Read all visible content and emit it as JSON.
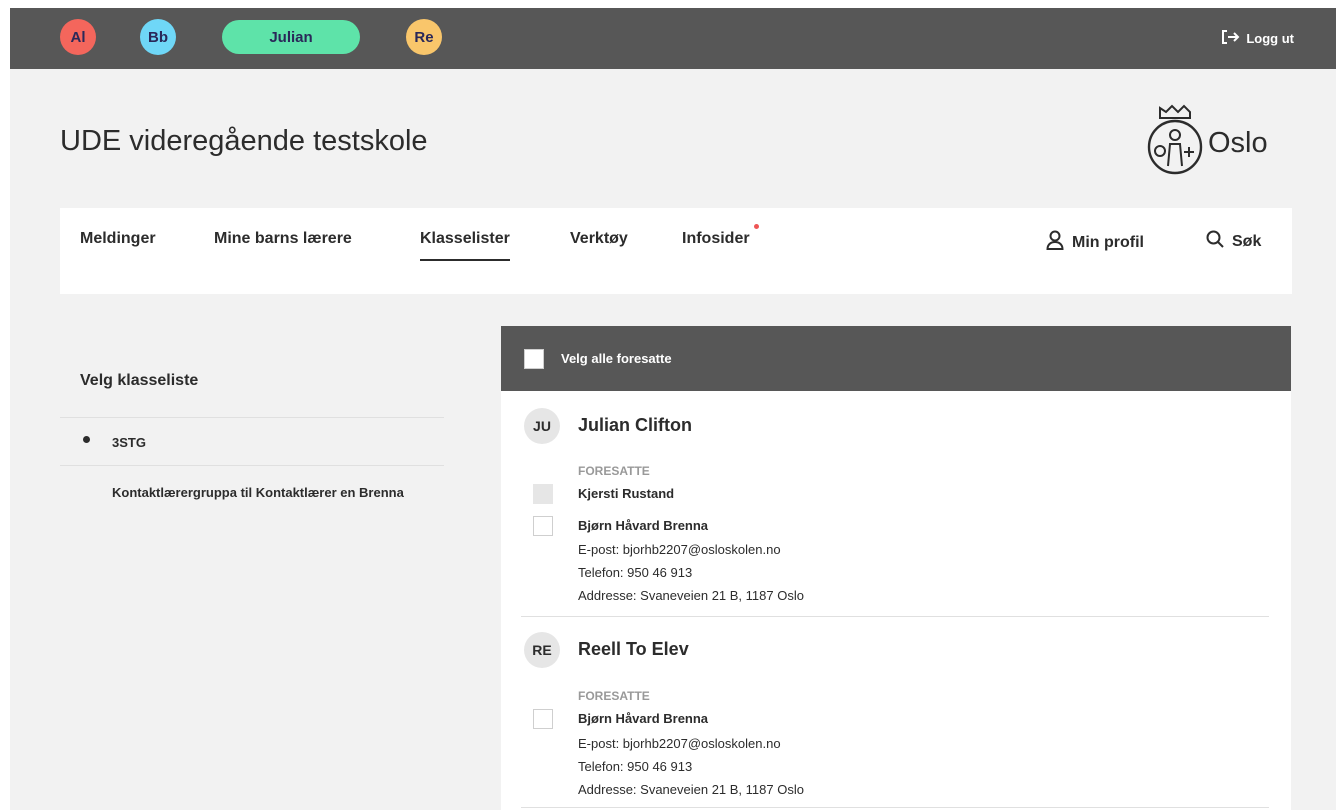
{
  "topbar": {
    "children": [
      {
        "label": "Al",
        "color": "#f4665c"
      },
      {
        "label": "Bb",
        "color": "#6fd7f7"
      },
      {
        "label": "Julian",
        "color": "#5ee3a9"
      },
      {
        "label": "Re",
        "color": "#f9c66b"
      }
    ],
    "logout_label": "Logg ut"
  },
  "header": {
    "school_name": "UDE videregående testskole",
    "logo_text": "Oslo"
  },
  "nav": {
    "items": [
      "Meldinger",
      "Mine barns lærere",
      "Klasselister",
      "Verktøy",
      "Infosider"
    ],
    "active": "Klasselister",
    "profile_label": "Min profil",
    "search_label": "Søk"
  },
  "sidebar": {
    "heading": "Velg klasseliste",
    "items": [
      "3STG",
      "Kontaktlærergruppa til Kontaktlærer en Brenna"
    ]
  },
  "panel": {
    "select_all_label": "Velg alle foresatte",
    "students": [
      {
        "initials": "JU",
        "name": "Julian Clifton",
        "guardians_label": "FORESATTE",
        "guardians": [
          {
            "name": "Kjersti Rustand",
            "checkbox_disabled": true
          },
          {
            "name": "Bjørn Håvard Brenna",
            "email": "E-post: bjorhb2207@osloskolen.no",
            "phone": "Telefon: 950 46 913",
            "address": "Addresse: Svaneveien 21 B, 1187 Oslo"
          }
        ]
      },
      {
        "initials": "RE",
        "name": "Reell To Elev",
        "guardians_label": "FORESATTE",
        "guardians": [
          {
            "name": "Bjørn Håvard Brenna",
            "email": "E-post: bjorhb2207@osloskolen.no",
            "phone": "Telefon: 950 46 913",
            "address": "Addresse: Svaneveien 21 B, 1187 Oslo"
          }
        ]
      }
    ]
  }
}
